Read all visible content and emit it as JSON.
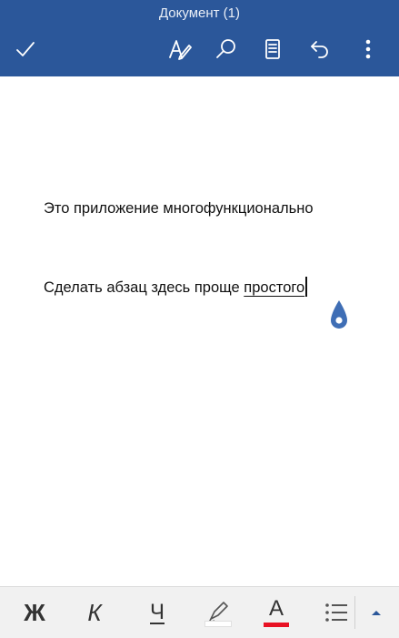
{
  "appbar": {
    "title": "Документ (1)",
    "icons": [
      "checkmark-icon",
      "proofing-icon",
      "search-icon",
      "reading-view-icon",
      "undo-icon",
      "more-icon"
    ],
    "background": "#2b579a"
  },
  "document": {
    "paragraph1": "Это приложение многофункционально",
    "paragraph2_plain": "Сделать абзац здесь проще ",
    "paragraph2_word": "простого"
  },
  "format_bar": {
    "bold_label": "Ж",
    "italic_label": "К",
    "underline_label": "Ч",
    "font_color_label": "A",
    "font_color": "#e81123",
    "highlight_color": "#ffffff",
    "icons": [
      "highlighter-icon",
      "bullet-list-icon",
      "expand-up-icon"
    ]
  },
  "colors": {
    "accent": "#2b579a",
    "handle": "#3f6eb5"
  }
}
